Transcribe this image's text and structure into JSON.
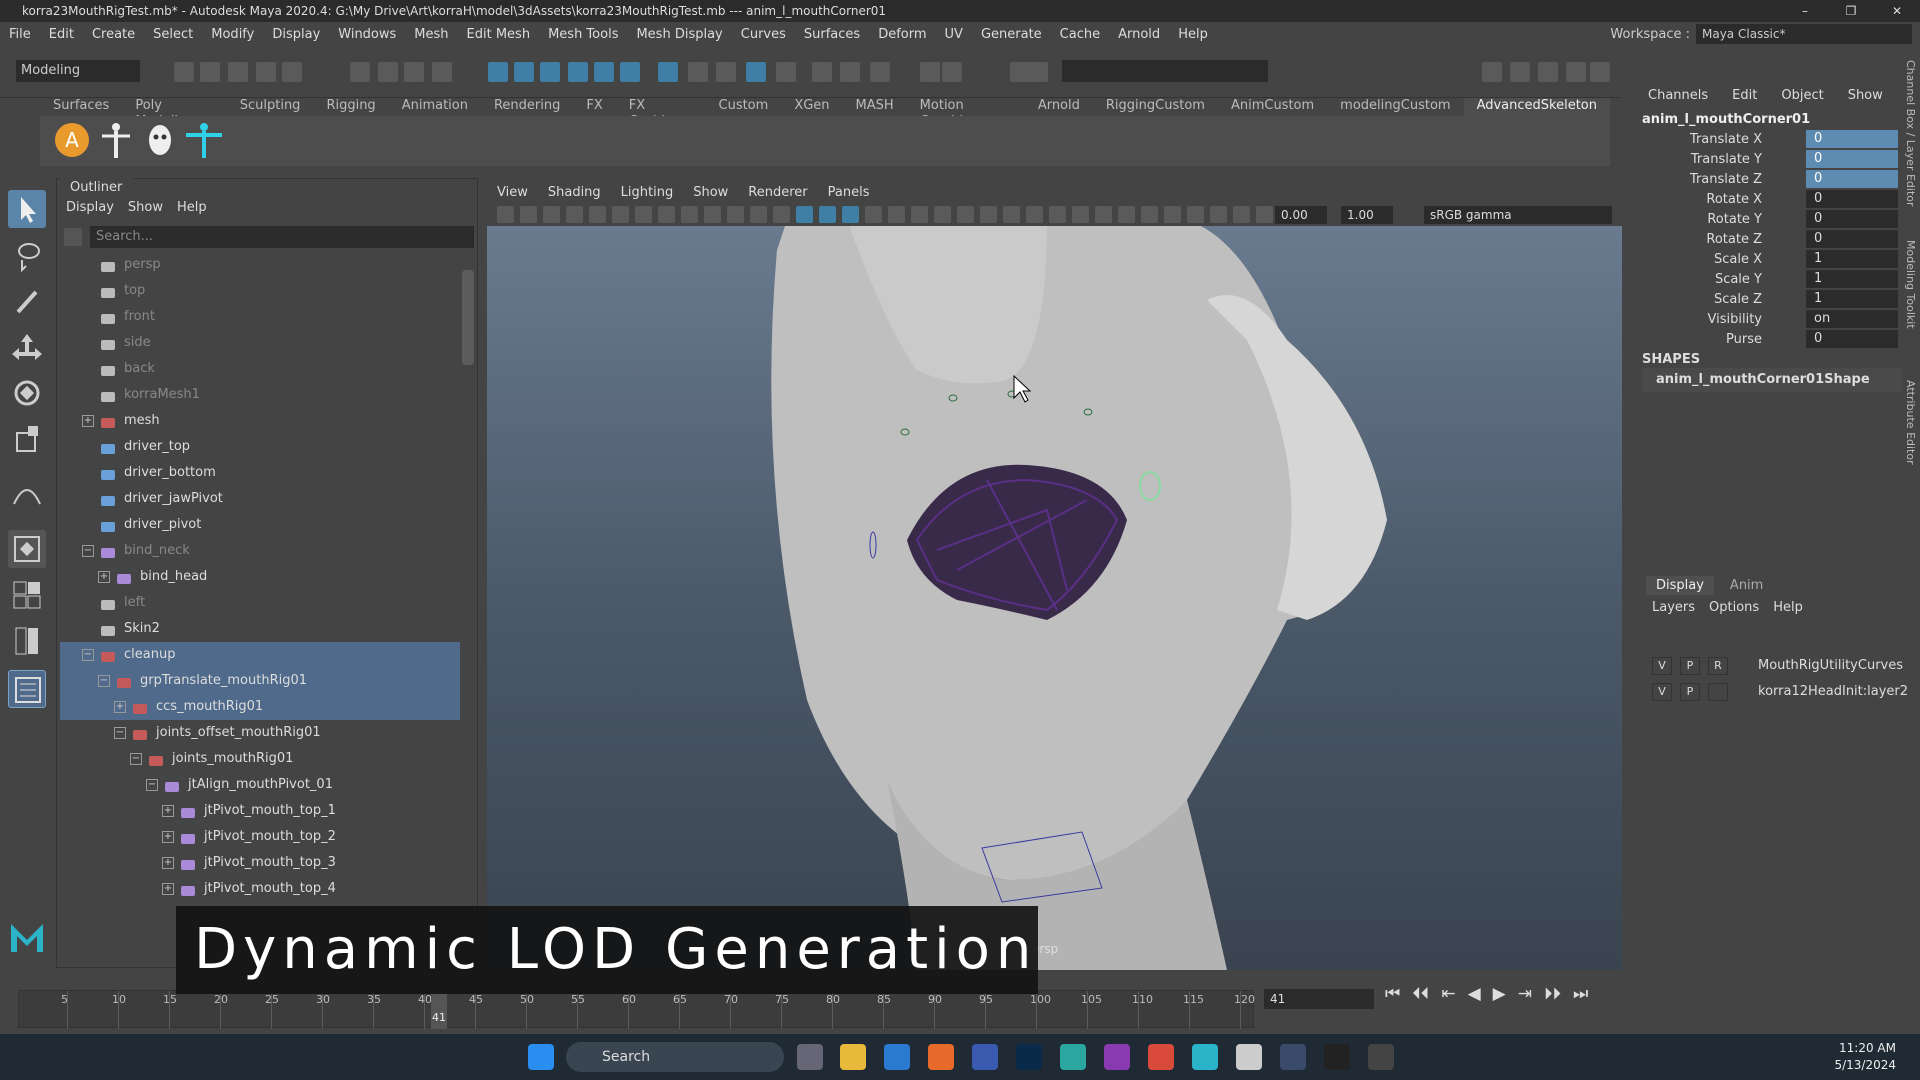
{
  "titlebar": {
    "title": "korra23MouthRigTest.mb* - Autodesk Maya 2020.4: G:\\My Drive\\Art\\korraH\\model\\3dAssets\\korra23MouthRigTest.mb   ---   anim_l_mouthCorner01",
    "minimize": "–",
    "maximize": "❐",
    "close": "✕"
  },
  "menubar": {
    "items": [
      "File",
      "Edit",
      "Create",
      "Select",
      "Modify",
      "Display",
      "Windows",
      "Mesh",
      "Edit Mesh",
      "Mesh Tools",
      "Mesh Display",
      "Curves",
      "Surfaces",
      "Deform",
      "UV",
      "Generate",
      "Cache",
      "Arnold",
      "Help"
    ],
    "workspace_label": "Workspace :",
    "workspace_value": "Maya Classic*"
  },
  "statusline": {
    "mode": "Modeling"
  },
  "shelf": {
    "tabs": [
      "Surfaces",
      "Poly Modeling",
      "Sculpting",
      "Rigging",
      "Animation",
      "Rendering",
      "FX",
      "FX Caching",
      "Custom",
      "XGen",
      "MASH",
      "Motion Graphics",
      "Arnold",
      "RiggingCustom",
      "AnimCustom",
      "modelingCustom",
      "AdvancedSkeleton"
    ],
    "active_tab": "AdvancedSkeleton",
    "icons": [
      "advanced-skeleton-icon",
      "biped-icon",
      "face-icon",
      "t-pose-icon"
    ],
    "icon_glyph": "A"
  },
  "outliner": {
    "tab": "Outliner",
    "menu": [
      "Display",
      "Show",
      "Help"
    ],
    "search_placeholder": "Search...",
    "rows": [
      {
        "label": "persp",
        "dim": true,
        "type": "camera"
      },
      {
        "label": "top",
        "dim": true,
        "type": "camera"
      },
      {
        "label": "front",
        "dim": true,
        "type": "camera"
      },
      {
        "label": "side",
        "dim": true,
        "type": "camera"
      },
      {
        "label": "back",
        "dim": true,
        "type": "camera"
      },
      {
        "label": "korraMesh1",
        "dim": true,
        "type": "mesh"
      },
      {
        "label": "mesh",
        "dim": false,
        "type": "group"
      },
      {
        "label": "driver_top",
        "dim": false,
        "type": "curve"
      },
      {
        "label": "driver_bottom",
        "dim": false,
        "type": "curve"
      },
      {
        "label": "driver_jawPivot",
        "dim": false,
        "type": "locator"
      },
      {
        "label": "driver_pivot",
        "dim": false,
        "type": "locator"
      },
      {
        "label": "bind_neck",
        "dim": true,
        "type": "joint"
      },
      {
        "label": "bind_head",
        "dim": false,
        "type": "joint"
      },
      {
        "label": "left",
        "dim": true,
        "type": "camera"
      },
      {
        "label": "Skin2",
        "dim": false,
        "type": "mesh"
      },
      {
        "label": "cleanup",
        "dim": false,
        "type": "group"
      },
      {
        "label": "grpTranslate_mouthRig01",
        "dim": false,
        "type": "group"
      },
      {
        "label": "ccs_mouthRig01",
        "dim": false,
        "type": "group"
      },
      {
        "label": "joints_offset_mouthRig01",
        "dim": false,
        "type": "group"
      },
      {
        "label": "joints_mouthRig01",
        "dim": false,
        "type": "group"
      },
      {
        "label": "jtAlign_mouthPivot_01",
        "dim": false,
        "type": "joint"
      },
      {
        "label": "jtPivot_mouth_top_1",
        "dim": false,
        "type": "joint"
      },
      {
        "label": "jtPivot_mouth_top_2",
        "dim": false,
        "type": "joint"
      },
      {
        "label": "jtPivot_mouth_top_3",
        "dim": false,
        "type": "joint"
      },
      {
        "label": "jtPivot_mouth_top_4",
        "dim": false,
        "type": "joint"
      }
    ]
  },
  "viewport": {
    "menu": [
      "View",
      "Shading",
      "Lighting",
      "Show",
      "Renderer",
      "Panels"
    ],
    "exposure": "0.00",
    "gamma_value": "1.00",
    "color_space": "sRGB gamma",
    "camera_label": "ersp"
  },
  "channelbox": {
    "menu": [
      "Channels",
      "Edit",
      "Object",
      "Show"
    ],
    "object": "anim_l_mouthCorner01",
    "attributes": [
      {
        "name": "Translate X",
        "value": "0",
        "keyed": true
      },
      {
        "name": "Translate Y",
        "value": "0",
        "keyed": true
      },
      {
        "name": "Translate Z",
        "value": "0",
        "keyed": true
      },
      {
        "name": "Rotate X",
        "value": "0",
        "keyed": false
      },
      {
        "name": "Rotate Y",
        "value": "0",
        "keyed": false
      },
      {
        "name": "Rotate Z",
        "value": "0",
        "keyed": false
      },
      {
        "name": "Scale X",
        "value": "1",
        "keyed": false
      },
      {
        "name": "Scale Y",
        "value": "1",
        "keyed": false
      },
      {
        "name": "Scale Z",
        "value": "1",
        "keyed": false
      },
      {
        "name": "Visibility",
        "value": "on",
        "keyed": false
      },
      {
        "name": "Purse",
        "value": "0",
        "keyed": false
      }
    ],
    "shapes_header": "SHAPES",
    "shape_name": "anim_l_mouthCorner01Shape"
  },
  "layers": {
    "tabs": [
      "Display",
      "Anim"
    ],
    "active_tab": "Display",
    "menu": [
      "Layers",
      "Options",
      "Help"
    ],
    "rows": [
      {
        "v": "V",
        "p": "P",
        "r": "R",
        "name": "MouthRigUtilityCurves"
      },
      {
        "v": "V",
        "p": "P",
        "r": "",
        "name": "korra12HeadInit:layer2"
      }
    ]
  },
  "sidetabs": [
    "Channel Box / Layer Editor",
    "Modeling Toolkit",
    "Attribute Editor"
  ],
  "timeline": {
    "ticks": [
      "5",
      "10",
      "15",
      "20",
      "25",
      "30",
      "35",
      "40",
      "45",
      "50",
      "55",
      "60",
      "65",
      "70",
      "75",
      "80",
      "85",
      "90",
      "95",
      "100",
      "105",
      "110",
      "115",
      "120"
    ],
    "playhead": "41",
    "current_frame": "41",
    "controls": [
      "⏮",
      "⏴⏴",
      "⇤",
      "◀",
      "▶",
      "⇥",
      "⏵⏵",
      "⏭"
    ]
  },
  "caption": "Dynamic LOD Generation",
  "taskbar": {
    "search": "Search",
    "time": "11:20 AM",
    "date": "5/13/2024"
  }
}
